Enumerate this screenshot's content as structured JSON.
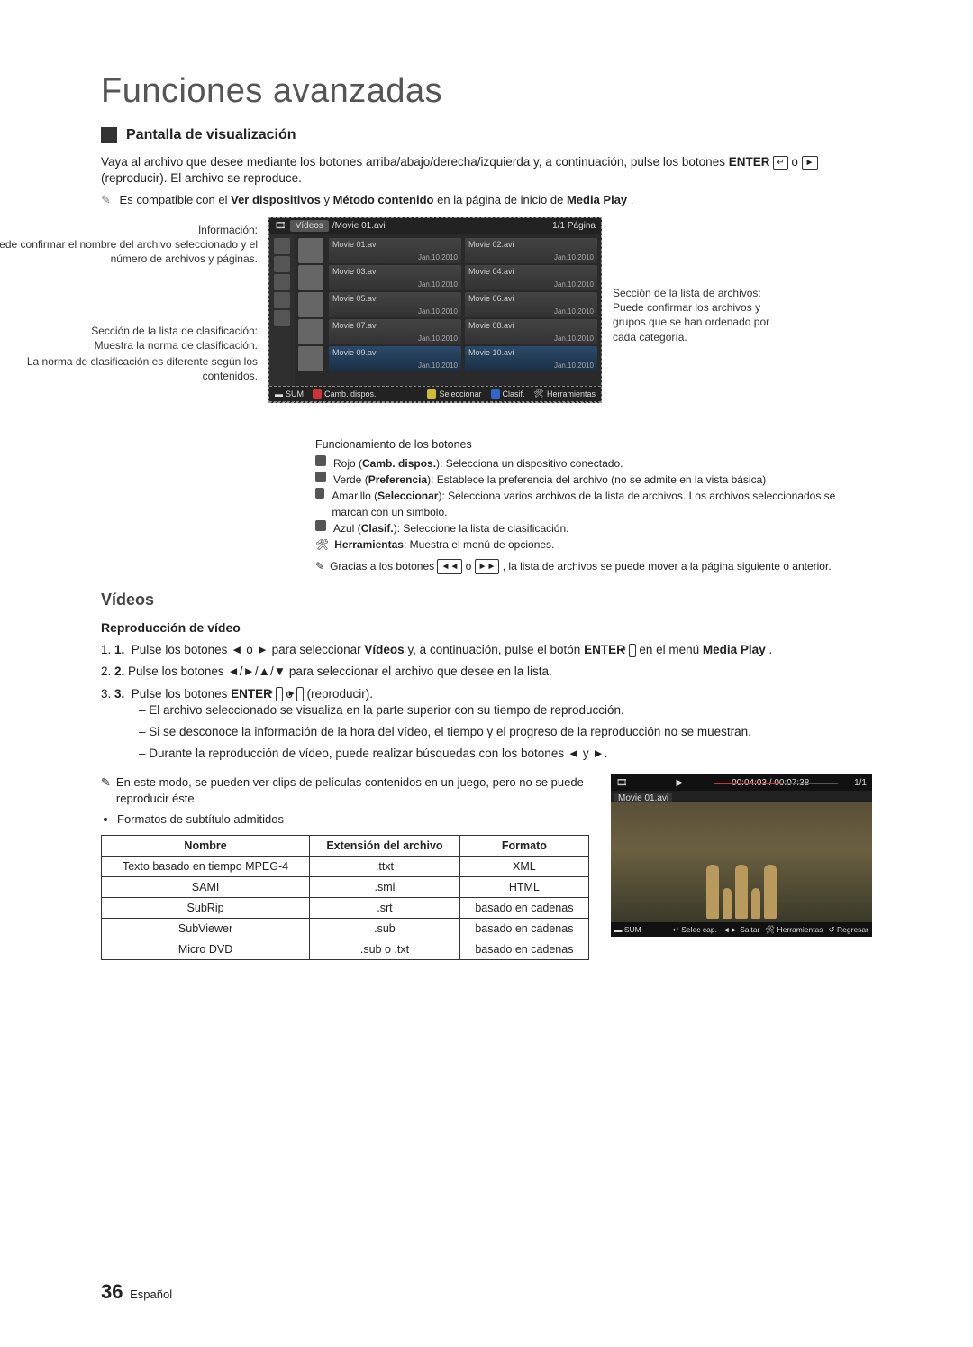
{
  "page": {
    "title": "Funciones avanzadas",
    "number": "36",
    "lang": "Español"
  },
  "section": {
    "heading": "Pantalla de visualización",
    "intro1_a": "Vaya al archivo que desee mediante los botones arriba/abajo/derecha/izquierda y, a continuación, pulse los botones ",
    "enter": "ENTER",
    "intro1_b": " o ",
    "intro1_c": " (reproducir). El archivo se reproduce.",
    "compat_a": "Es compatible con el ",
    "compat_b": "Ver dispositivos",
    "compat_c": " y ",
    "compat_d": "Método contenido",
    "compat_e": " en la página de inicio de ",
    "compat_f": "Media Play",
    "compat_g": "."
  },
  "callouts": {
    "info_title": "Información:",
    "info_body": "Puede confirmar el nombre del archivo seleccionado y el número de archivos y páginas.",
    "class_title": "Sección de la lista de clasificación:",
    "class_body": "Muestra la norma de clasificación.",
    "class_note": "La norma de clasificación es diferente según los contenidos.",
    "files_title": "Sección de la lista de archivos:",
    "files_body": "Puede confirmar los archivos y grupos que se han ordenado por cada categoría."
  },
  "mp": {
    "tab": "Vídeos",
    "path": "/Movie 01.avi",
    "page": "1/1 Página",
    "files": [
      {
        "n": "Movie 01.avi",
        "d": "Jan.10.2010"
      },
      {
        "n": "Movie 02.avi",
        "d": "Jan.10.2010"
      },
      {
        "n": "Movie 03.avi",
        "d": "Jan.10.2010"
      },
      {
        "n": "Movie 04.avi",
        "d": "Jan.10.2010"
      },
      {
        "n": "Movie 05.avi",
        "d": "Jan.10.2010"
      },
      {
        "n": "Movie 06.avi",
        "d": "Jan.10.2010"
      },
      {
        "n": "Movie 07.avi",
        "d": "Jan.10.2010"
      },
      {
        "n": "Movie 08.avi",
        "d": "Jan.10.2010"
      },
      {
        "n": "Movie 09.avi",
        "d": "Jan.10.2010"
      },
      {
        "n": "Movie 10.avi",
        "d": "Jan.10.2010"
      }
    ],
    "footer": {
      "sum": "SUM",
      "a": "Camb. dispos.",
      "c": "Seleccionar",
      "d": "Clasif.",
      "tools": "Herramientas"
    }
  },
  "ops": {
    "heading": "Funcionamiento de los botones",
    "a_pre": "Rojo (",
    "a_bold": "Camb. dispos.",
    "a_post": "): Selecciona un dispositivo conectado.",
    "b_pre": "Verde (",
    "b_bold": "Preferencia",
    "b_post": "): Establece la preferencia del archivo (no se admite en la vista básica)",
    "c_pre": "Amarillo (",
    "c_bold": "Seleccionar",
    "c_post": "): Selecciona varios archivos de la lista de archivos. Los archivos seleccionados se marcan con un símbolo.",
    "d_pre": "Azul (",
    "d_bold": "Clasif.",
    "d_post": "): Seleccione la lista de clasificación.",
    "t_bold": "Herramientas",
    "t_post": ": Muestra el menú de opciones.",
    "note_a": "Gracias a los botones ",
    "note_b": " o ",
    "note_c": ", la lista de archivos se puede mover a la página siguiente o anterior."
  },
  "videos": {
    "title": "Vídeos",
    "sub": "Reproducción de vídeo",
    "s1_a": "Pulse los botones ◄ o ► para seleccionar ",
    "s1_b": "Vídeos",
    "s1_c": " y, a continuación, pulse el botón ",
    "s1_d": "ENTER",
    "s1_e": " en el menú ",
    "s1_f": "Media Play",
    "s1_g": ".",
    "s2": "Pulse los botones ◄/►/▲/▼ para seleccionar el archivo que desee en la lista.",
    "s3_a": "Pulse los botones ",
    "s3_b": "ENTER",
    "s3_c": " o ",
    "s3_d": " (reproducir).",
    "b1": "El archivo seleccionado se visualiza en la parte superior con su tiempo de reproducción.",
    "b2": "Si se desconoce la información de la hora del vídeo, el tiempo y el progreso de la reproducción no se muestran.",
    "b3": "Durante la reproducción de vídeo, puede realizar búsquedas con los botones ◄ y ►.",
    "note": "En este modo, se pueden ver clips de películas contenidos en un juego, pero no se puede reproducir éste.",
    "formats": "Formatos de subtítulo admitidos"
  },
  "table": {
    "h1": "Nombre",
    "h2": "Extensión del archivo",
    "h3": "Formato",
    "rows": [
      {
        "n": "Texto basado en tiempo MPEG-4",
        "e": ".ttxt",
        "f": "XML"
      },
      {
        "n": "SAMI",
        "e": ".smi",
        "f": "HTML"
      },
      {
        "n": "SubRip",
        "e": ".srt",
        "f": "basado en cadenas"
      },
      {
        "n": "SubViewer",
        "e": ".sub",
        "f": "basado en cadenas"
      },
      {
        "n": "Micro DVD",
        "e": ".sub o .txt",
        "f": "basado en cadenas"
      }
    ]
  },
  "preview": {
    "time": "00:04:03 / 00:07:38",
    "page": "1/1",
    "name": "Movie 01.avi",
    "sum": "SUM",
    "sel": "Selec cap.",
    "jump": "Saltar",
    "tools": "Herramientas",
    "ret": "Regresar"
  }
}
